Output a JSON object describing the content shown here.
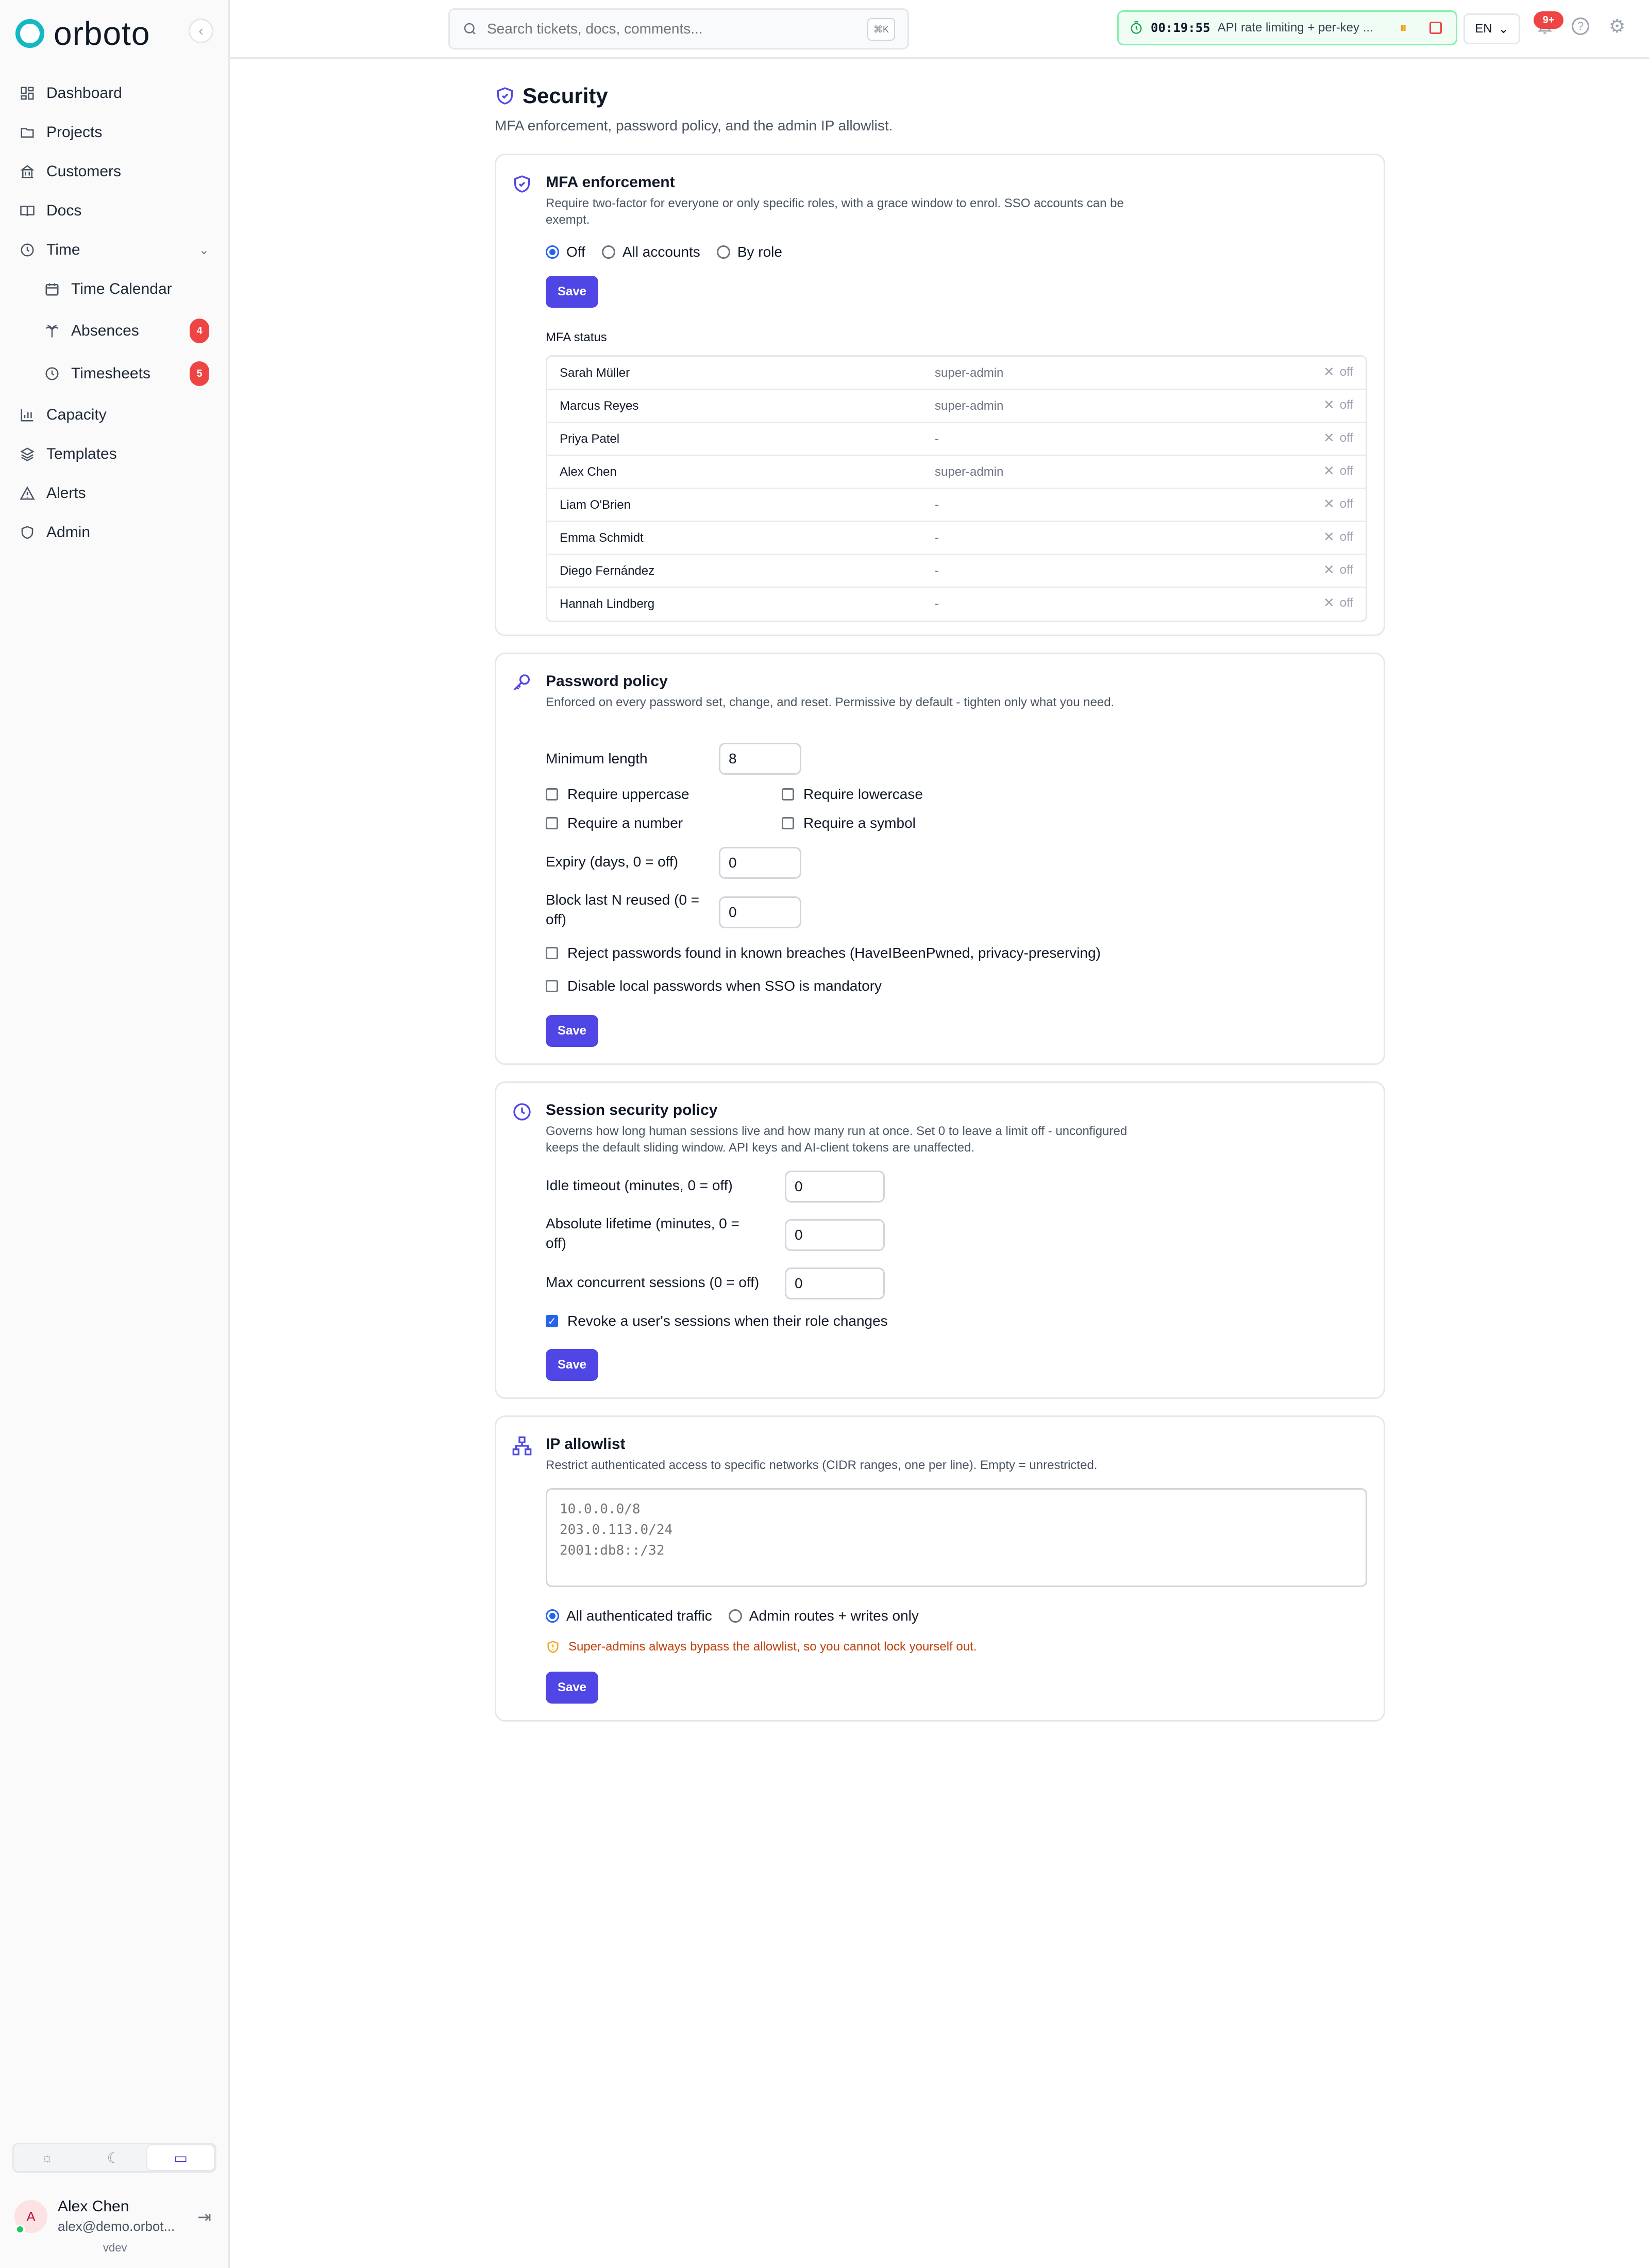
{
  "app": {
    "logo_text": "orboto",
    "brand_color": "#14b8c4",
    "accent_color": "#4f46e5"
  },
  "sidebar": {
    "items": [
      {
        "label": "Dashboard",
        "icon": "dashboard-icon"
      },
      {
        "label": "Projects",
        "icon": "folder-icon"
      },
      {
        "label": "Customers",
        "icon": "building-icon"
      },
      {
        "label": "Docs",
        "icon": "book-icon"
      },
      {
        "label": "Time",
        "icon": "clock-icon"
      },
      {
        "label": "Time Calendar",
        "icon": "calendar-icon"
      },
      {
        "label": "Absences",
        "icon": "palm-icon",
        "badge": "4"
      },
      {
        "label": "Timesheets",
        "icon": "clock-icon",
        "badge": "5"
      },
      {
        "label": "Capacity",
        "icon": "bar-chart-icon"
      },
      {
        "label": "Templates",
        "icon": "layers-icon"
      },
      {
        "label": "Alerts",
        "icon": "alert-triangle-icon"
      },
      {
        "label": "Admin",
        "icon": "shield-icon"
      }
    ],
    "theme_options": [
      "sun-icon",
      "moon-icon",
      "monitor-icon"
    ],
    "user": {
      "initial": "A",
      "name": "Alex Chen",
      "email": "alex@demo.orbot...",
      "version": "vdev"
    }
  },
  "topbar": {
    "search_placeholder": "Search tickets, docs, comments...",
    "search_shortcut": "⌘K",
    "timer_time": "00:19:55",
    "timer_task": "API rate limiting + per-key ...",
    "language": "EN",
    "notification_count": "9+"
  },
  "page": {
    "title": "Security",
    "description": "MFA enforcement, password policy, and the admin IP allowlist."
  },
  "mfa": {
    "title": "MFA enforcement",
    "description": "Require two-factor for everyone or only specific roles, with a grace window to enrol. SSO accounts can be exempt.",
    "options": [
      "Off",
      "All accounts",
      "By role"
    ],
    "selected": "Off",
    "save_label": "Save",
    "status_label": "MFA status",
    "users": [
      {
        "name": "Sarah Müller",
        "role": "super-admin",
        "status": "off"
      },
      {
        "name": "Marcus Reyes",
        "role": "super-admin",
        "status": "off"
      },
      {
        "name": "Priya Patel",
        "role": "-",
        "status": "off"
      },
      {
        "name": "Alex Chen",
        "role": "super-admin",
        "status": "off"
      },
      {
        "name": "Liam O'Brien",
        "role": "-",
        "status": "off"
      },
      {
        "name": "Emma Schmidt",
        "role": "-",
        "status": "off"
      },
      {
        "name": "Diego Fernández",
        "role": "-",
        "status": "off"
      },
      {
        "name": "Hannah Lindberg",
        "role": "-",
        "status": "off"
      }
    ]
  },
  "password": {
    "title": "Password policy",
    "description": "Enforced on every password set, change, and reset. Permissive by default - tighten only what you need.",
    "min_length_label": "Minimum length",
    "min_length_value": "8",
    "require_uppercase": "Require uppercase",
    "require_lowercase": "Require lowercase",
    "require_number": "Require a number",
    "require_symbol": "Require a symbol",
    "expiry_label": "Expiry (days, 0 = off)",
    "expiry_value": "0",
    "block_reuse_label": "Block last N reused (0 = off)",
    "block_reuse_value": "0",
    "reject_breached": "Reject passwords found in known breaches (HaveIBeenPwned, privacy-preserving)",
    "disable_local": "Disable local passwords when SSO is mandatory",
    "save_label": "Save"
  },
  "session": {
    "title": "Session security policy",
    "description": "Governs how long human sessions live and how many run at once. Set 0 to leave a limit off - unconfigured keeps the default sliding window. API keys and AI-client tokens are unaffected.",
    "idle_label": "Idle timeout (minutes, 0 = off)",
    "idle_value": "0",
    "absolute_label": "Absolute lifetime (minutes, 0 = off)",
    "absolute_value": "0",
    "concurrent_label": "Max concurrent sessions (0 = off)",
    "concurrent_value": "0",
    "revoke_label": "Revoke a user's sessions when their role changes",
    "revoke_checked": true,
    "save_label": "Save"
  },
  "ip": {
    "title": "IP allowlist",
    "description": "Restrict authenticated access to specific networks (CIDR ranges, one per line). Empty = unrestricted.",
    "placeholder": "10.0.0.0/8\n203.0.113.0/24\n2001:db8::/32",
    "options": [
      "All authenticated traffic",
      "Admin routes + writes only"
    ],
    "selected": "All authenticated traffic",
    "warning": "Super-admins always bypass the allowlist, so you cannot lock yourself out.",
    "warning_color": "#c2410c",
    "save_label": "Save"
  }
}
